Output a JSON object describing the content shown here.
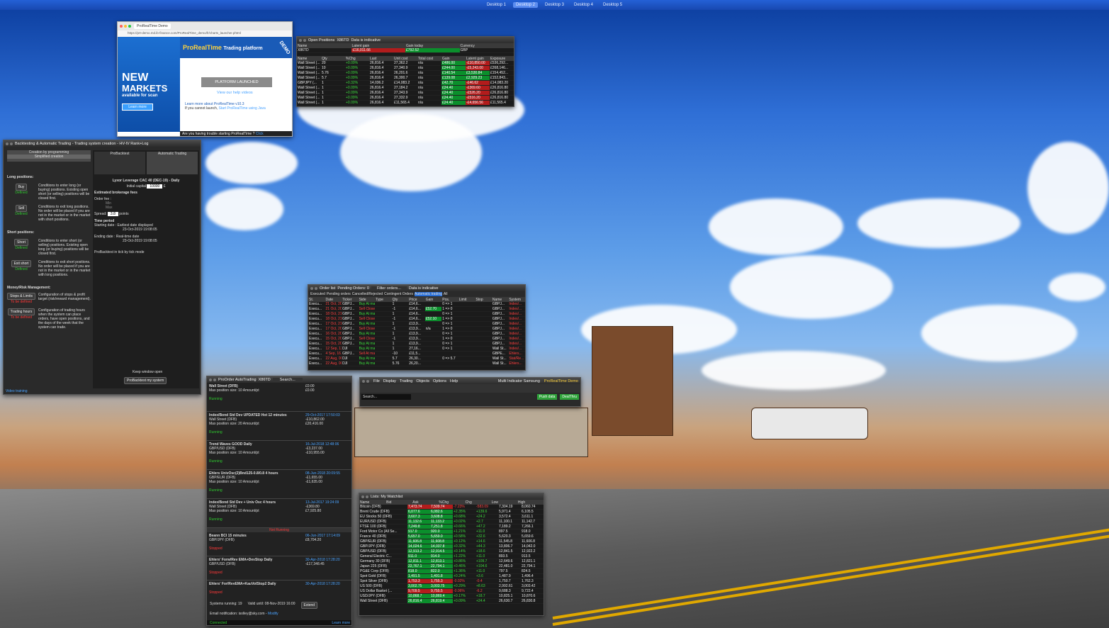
{
  "desktops": [
    "Desktop 1",
    "Desktop 2",
    "Desktop 3",
    "Desktop 4",
    "Desktop 5"
  ],
  "active_desktop": "Desktop 2",
  "launcher": {
    "tab_title": "ProRealTime Demo",
    "url": "https://prt-demo.md.ib-finance.com/ProRealTime_demo/fr/charts_launcher.phtml",
    "headline1": "NEW",
    "headline2": "MARKETS",
    "sub": "available for scan",
    "learn": "Learn more",
    "brand": "ProRealTime",
    "brand_suffix": "Trading platform",
    "demo": "DEMO",
    "launched": "PLATFORM LAUNCHED",
    "help_videos": "View our help videos",
    "more": "Learn more about ProRealTime v10.3",
    "cannot": "If you cannot launch,",
    "start_java": "Start ProRealTime using Java",
    "trouble": "Are you having trouble starting ProRealTime ?",
    "click": "Click"
  },
  "open_positions": {
    "title": "Open Positions",
    "account": "X86TD",
    "indicative": "Data is indicative",
    "summary_headers": [
      "Name",
      "Latent gain",
      "Gain today",
      "Currency"
    ],
    "summary": [
      "X86TD",
      "-£16,011.66",
      "£792.52",
      "GBP"
    ],
    "headers": [
      "Name",
      "Qty",
      "%Chg",
      "Last",
      "Unit cost",
      "Total cost",
      "Gain",
      "Latent gain",
      "Exposure"
    ],
    "rows": [
      [
        "Wall Street (...",
        "20",
        "+0.09%",
        "26,816.4",
        "27,362.2",
        "n/a",
        "£486.00",
        "-£10,850.00",
        "£536,292..."
      ],
      [
        "Wall Street (...",
        "10",
        "+0.09%",
        "26,816.4",
        "27,340.9",
        "n/a",
        "£244.00",
        "-£5,243.00",
        "£268,146..."
      ],
      [
        "Wall Street (...",
        "5.76",
        "+0.09%",
        "26,816.4",
        "26,201.6",
        "n/a",
        "£140.54",
        "£3,530.84",
        "£154,452..."
      ],
      [
        "Wall Street (...",
        "5.7",
        "+0.09%",
        "26,816.4",
        "26,300.7",
        "n/a",
        "£139.08",
        "£2,929.23",
        "£152,843..."
      ],
      [
        "GBPJPY (...",
        "1",
        "+0.32%",
        "14,036.2",
        "£14,083.2",
        "n/a",
        "£42.70",
        "-£46.62",
        "£14,083.20"
      ],
      [
        "Wall Street (...",
        "1",
        "+0.09%",
        "26,816.4",
        "27,184.2",
        "n/a",
        "£24.40",
        "-£369.60",
        "£26,816.80"
      ],
      [
        "Wall Street (...",
        "1",
        "+0.09%",
        "26,816.4",
        "27,343.9",
        "n/a",
        "£24.40",
        "-£526.20",
        "£26,816.80"
      ],
      [
        "Wall Street (...",
        "1",
        "+0.09%",
        "26,816.4",
        "27,332.9",
        "n/a",
        "£24.40",
        "-£516.20",
        "£26,816.80"
      ],
      [
        "Wall Street (...",
        "1",
        "+0.09%",
        "26,816.4",
        "£11,565.4",
        "n/a",
        "£24.40",
        "-£4,656.56",
        "£11,565.4"
      ]
    ]
  },
  "backtest": {
    "title": "Backtesting & Automatic Trading - Trading system creation - HV-IV Rank+Log",
    "tab1": "Creation by programming",
    "tab2": "Simplified creation",
    "long": "Long positions:",
    "buy": "Buy",
    "defined": "Defined",
    "buy_desc": "Conditions to enter long (or buying) positions. Existing open short (or selling) positions will be closed first.",
    "sell": "Sell",
    "sell_desc": "Conditions to exit long positions. No order will be placed if you are not in the market or in the market with short positions.",
    "short": "Short positions:",
    "short_btn": "Short",
    "short_desc": "Conditions to enter short (or selling) positions. Existing open long (or buying) positions will be closed first.",
    "exit": "Exit short",
    "exit_desc": "Conditions to exit short positions. No order will be placed if you are not in the market or in the market with long positions.",
    "money": "Money/Risk Management:",
    "stops": "Stops & Limits",
    "tobe": "To be defined",
    "stops_desc": "Configuration of stops & profit target (risk/reward management).",
    "hours": "Trading hours",
    "hours_desc": "Configuration of trading hours when the system can place orders, have open positions, and the days of the week that the system can trade.",
    "video": "Video training",
    "pb": "ProBacktest",
    "at": "Automatic Trading",
    "instrument": "Lyxor Leverage CAC 40 (DEC-19) - Daily",
    "capital_label": "Initial capital",
    "capital": "10000",
    "capital_cur": "£",
    "fees": "Estimated brokerage fees",
    "order_fee": "Order fee :",
    "min": "Min",
    "max": "Max",
    "spread": "Spread:",
    "spread_val": "3.8",
    "points": "points",
    "period": "Time period",
    "starting": "Starting date :",
    "earliest": "Earliest date displayed",
    "date1": "23-Oct-2019 19:08:05",
    "ending": "Ending date :",
    "realtime": "Real-time date",
    "date2": "23-Oct-2019 19:08:05",
    "tick": "ProBacktest in tick by tick mode",
    "keep": "Keep window open",
    "run": "ProBacktest my system"
  },
  "orders": {
    "title": "Order list",
    "pending": "Pending Orders: 0",
    "filter": "Filter orders...",
    "indicative": "Data is indicative",
    "tabs": [
      "Executed",
      "Pending orders",
      "Cancelled/Rejected",
      "Contingent Orders",
      "Automatic trading",
      "All"
    ],
    "headers": [
      "St.",
      "Date",
      "Ticker",
      "Side",
      "Type",
      "Qty",
      "Price",
      "Gain",
      "Pos.",
      "Limit",
      "Stop",
      "Name",
      "System"
    ],
    "rows": [
      [
        "Execu...",
        "21 Oct, 20...",
        "GBPJ...",
        "Buy At mar...",
        "",
        "1",
        "£14,6...",
        "",
        "0 => 1",
        "",
        "",
        "GBPJ...",
        "Index/..."
      ],
      [
        "Execu...",
        "21 Oct, 20...",
        "GBPJ...",
        "Sell Close ...",
        "",
        "-1",
        "£14,6...",
        "£52.70",
        "1 => 0",
        "",
        "",
        "GBPJ...",
        "Index/..."
      ],
      [
        "Execu...",
        "18 Oct, 21...",
        "GBPJ...",
        "Buy At mar...",
        "",
        "1",
        "£14,6...",
        "",
        "0 => 1",
        "",
        "",
        "GBPJ...",
        "Index/..."
      ],
      [
        "Execu...",
        "18 Oct, 21...",
        "GBPJ...",
        "Sell Close ...",
        "",
        "-1",
        "£14,6...",
        "£52.10",
        "1 => 0",
        "",
        "",
        "GBPJ...",
        "Index/..."
      ],
      [
        "Execu...",
        "17 Oct, 21...",
        "GBPJ...",
        "Buy At mar...",
        "",
        "1",
        "£13,9...",
        "",
        "0 => 1",
        "",
        "",
        "GBPJ...",
        "Index/..."
      ],
      [
        "Execu...",
        "17 Oct, 20...",
        "GBPJ...",
        "Sell Close ...",
        "",
        "-1",
        "£13,9...",
        "n/a",
        "1 => 0",
        "",
        "",
        "GBPJ...",
        "Index/..."
      ],
      [
        "Execu...",
        "16 Oct, 20...",
        "GBPJ...",
        "Buy At mar...",
        "",
        "1",
        "£13,9...",
        "",
        "0 => 1",
        "",
        "",
        "GBPJ...",
        "Index/..."
      ],
      [
        "Execu...",
        "15 Oct, 20...",
        "GBPJ...",
        "Sell Close ...",
        "",
        "-1",
        "£13,9...",
        "",
        "1 => 0",
        "",
        "",
        "GBPJ...",
        "Index/..."
      ],
      [
        "Execu...",
        "15 Oct, 20...",
        "GBPJ...",
        "Buy At mar...",
        "",
        "1",
        "£13,9...",
        "",
        "0 => 1",
        "",
        "",
        "GBPJ...",
        "Index/..."
      ],
      [
        "Execu...",
        "12 Sep, 12...",
        "DJI",
        "Buy At mar...",
        "",
        "1",
        "27,16...",
        "",
        "0 => 1",
        "",
        "",
        "Wall St...",
        "Index/..."
      ],
      [
        "Execu...",
        "4 Sep, 16...",
        "GBPJ...",
        "Sell At mar...",
        "",
        "-10",
        "£11,5...",
        "",
        "",
        "",
        "",
        "GBPE...",
        "Ehlers..."
      ],
      [
        "Execu...",
        "22 Aug, 00...",
        "DJI",
        "Buy At mar...",
        "",
        "5.7",
        "26,30...",
        "",
        "0 => 5.7",
        "",
        "",
        "Wall St...",
        "Stat/Re..."
      ],
      [
        "Execu...",
        "22 Aug, 00...",
        "DJI",
        "Buy At mar...",
        "",
        "5.76",
        "26,20...",
        "",
        "",
        "",
        "",
        "Wall St...",
        "Ehlers..."
      ]
    ]
  },
  "prorder": {
    "title": "ProOrder AutoTrading",
    "account": "X86TD",
    "search": "Search...",
    "running": "Running",
    "notrunning": "Not Running",
    "stopped": "Stopped",
    "systems": [
      {
        "name": "Wall Street (DFB)",
        "maxpos": "Max position size: 10 Amount/pt",
        "latent": "Latent gain:",
        "latent_v": "£0.00",
        "total": "Total gain:",
        "total_v": "£0.00",
        "perf": "View performance",
        "status": "Running"
      },
      {
        "name": "Index/Bond Std Dev UPDATED Hot 12 minutes",
        "date": "29-Oct-2017 17:50:03",
        "position": "Position:",
        "latent_v": "-£10,862.00",
        "total_v": "£20,416.00",
        "inst": "Wall Street (DFB)",
        "maxpos": "Max position size: 20 Amount/pt",
        "status": "Running"
      },
      {
        "name": "Trend Waves GOOD Daily",
        "date": "16-Jul-2018 12:48:06",
        "latent_v": "-£3,237.00",
        "total_v": "-£10,955.00",
        "inst": "GBP/USD (DFB)",
        "maxpos": "Max position size: 10 Amount/pt",
        "status": "Running"
      },
      {
        "name": "Ehlers UnivOsc(2)Bnd125-0.8/0.8 4 hours",
        "date": "08-Jun-2018 20:09:55",
        "latent_v": "-£1,655.00",
        "total_v": "-£1,635.00",
        "inst": "GBP/EUR (DFB)",
        "maxpos": "Max position size: 10 Amount/pt",
        "status": "Running"
      },
      {
        "name": "Index/Bond Std Dev + Univ Osc 4 hours",
        "date": "13-Jul-2017 19:24:09",
        "latent_v": "-£369.80",
        "total_v": "£7,925.80",
        "inst": "Wall Street (DFB)",
        "maxpos": "Max position size: 10 Amount/pt",
        "status": "Running"
      },
      {
        "name": "Beann BCI 15 minutes",
        "code": "Code version:",
        "date": "06-Jun-2017 17:14:09",
        "total_v": "£8,704.20",
        "inst": "GBP/JPY (DFB)",
        "status": "Stopped"
      },
      {
        "name": "Ehlers' Forw/Rev EMA+DevStop Daily",
        "date": "30-Apr-2018 17:28:20",
        "total_v": "-£17,348.45",
        "inst": "GBP/USD (DFB)",
        "status": "Stopped"
      },
      {
        "name": "Ehlers' For/RevEMA+KauVolStop2 Daily",
        "date": "30-Apr-2018 17:28:20",
        "status": "Stopped"
      }
    ],
    "systems_running": "Systems running: 19",
    "valid": "Valid until: 08-Nov-2019 16:00",
    "extend": "Extend",
    "email": "Email notification: isolley@sky.com -",
    "modify": "Modify",
    "connected": "Connected",
    "learn": "Learn more"
  },
  "toolbar": {
    "menus": [
      "File",
      "Display",
      "Trading",
      "Objects",
      "Options",
      "Help"
    ],
    "right": "Multi Indicator Samsung",
    "brand": "ProRealTime Demo",
    "search": "Search...",
    "push": "Push data",
    "dealthru": "DealThru"
  },
  "watchlist": {
    "title": "Lists: My Watchlist",
    "headers": [
      "Name",
      "Bid",
      "Ask",
      "%Chg",
      "Chg",
      "Low",
      "High"
    ],
    "rows": [
      [
        "Bitcoin (DFB)",
        "7,473.74",
        "7,509.74",
        "-7.23%",
        "-583.09",
        "7,304.19",
        "8,060.74",
        "r"
      ],
      [
        "Brent Crude (DFB)",
        "6,077.6",
        "6,082.6",
        "+2.35%",
        "+139.6",
        "5,971.4",
        "6,105.5",
        "g"
      ],
      [
        "EU Stocks 50 (DFB)",
        "3,607.3",
        "3,608.8",
        "+0.68%",
        "+24.2",
        "3,572.4",
        "3,611.1",
        "g"
      ],
      [
        "EUR/USD (DFB)",
        "11,132.6",
        "11,133.2",
        "+0.02%",
        "+2.7",
        "11,100.1",
        "11,142.7",
        "g"
      ],
      [
        "FTSE 100 (DFB)",
        "7,249.8",
        "7,251.8",
        "+0.66%",
        "+47.2",
        "7,189.2",
        "7,266.1",
        "g"
      ],
      [
        "Ford Motor Co (All Se...",
        "917.0",
        "920.0",
        "+1.21%",
        "+11.0",
        "897.5",
        "918.0",
        "g"
      ],
      [
        "France 40 (DFB)",
        "5,657.0",
        "5,659.0",
        "+0.58%",
        "+32.6",
        "5,620.3",
        "5,659.6",
        "g"
      ],
      [
        "GBP/EUR (DFB)",
        "11,606.8",
        "11,608.8",
        "+0.12%",
        "+14.6",
        "11,545.8",
        "11,606.8",
        "g"
      ],
      [
        "GBP/JPY (DFB)",
        "14,024.6",
        "14,037.8",
        "+0.32%",
        "+44.3",
        "13,806.7",
        "14,042.0",
        "g"
      ],
      [
        "GBP/USD (DFB)",
        "12,913.2",
        "12,914.5",
        "+0.14%",
        "+18.6",
        "12,841.5",
        "12,922.2",
        "g"
      ],
      [
        "General Electric C...",
        "911.0",
        "914.0",
        "+1.22%",
        "+11.0",
        "893.5",
        "913.5",
        "g"
      ],
      [
        "Germany 30 (DFB)",
        "12,811.1",
        "12,813.1",
        "+0.86%",
        "+109.7",
        "12,649.6",
        "12,821.1",
        "g"
      ],
      [
        "Japan 225 (DFB)",
        "22,767.1",
        "22,794.1",
        "+0.46%",
        "+104.6",
        "22,481.0",
        "22,794.1",
        "g"
      ],
      [
        "PG&E Corp (DFB)",
        "818.0",
        "822.0",
        "+1.36%",
        "+11.0",
        "797.5",
        "824.5",
        "g"
      ],
      [
        "Spot Gold (DFB)",
        "1,491.5",
        "1,491.8",
        "+0.24%",
        "+3.6",
        "1,487.9",
        "1,496.4",
        "g"
      ],
      [
        "Spot Silver (DFB)",
        "1,753.3",
        "1,755.3",
        "-0.02%",
        "-0.4",
        "1,750.7",
        "1,762.3",
        "r"
      ],
      [
        "US 500 (DFB)",
        "3,002.75",
        "3,003.75",
        "+0.29%",
        "+8.63",
        "2,992.61",
        "3,003.42",
        "g"
      ],
      [
        "US Dollar Basket (...",
        "9,709.5",
        "9,755.5",
        "-0.06%",
        "-6.2",
        "9,688.3",
        "9,722.4",
        "r"
      ],
      [
        "USD/JPY (DFB)",
        "10,868.7",
        "10,869.4",
        "+0.17%",
        "+18.7",
        "10,825.1",
        "10,870.6",
        "g"
      ],
      [
        "Wall Street (DFB)",
        "26,816.4",
        "26,819.4",
        "+0.09%",
        "+24.4",
        "26,630.7",
        "26,830.8",
        "g"
      ]
    ]
  }
}
